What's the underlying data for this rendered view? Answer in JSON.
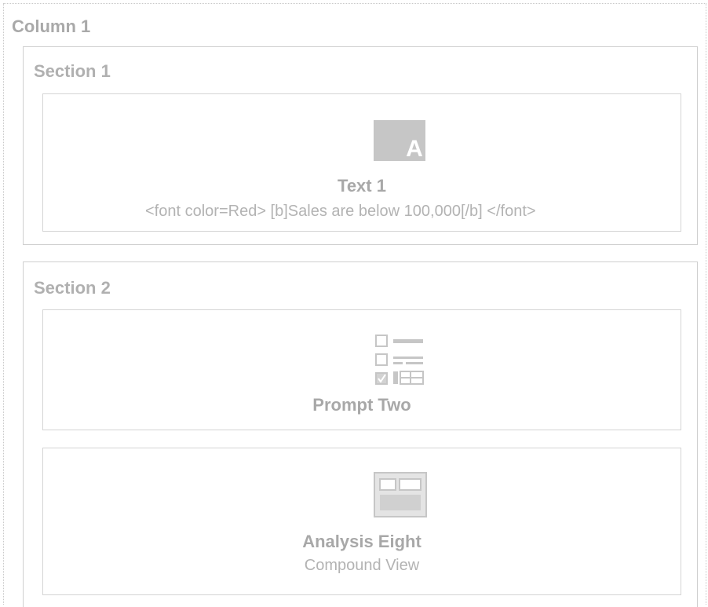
{
  "column": {
    "title": "Column 1"
  },
  "sections": [
    {
      "title": "Section 1",
      "items": [
        {
          "icon": "text-icon",
          "icon_letter": "A",
          "title": "Text 1",
          "subtitle": "<font color=Red> [b]Sales are below 100,000[/b] </font>"
        }
      ]
    },
    {
      "title": "Section 2",
      "items": [
        {
          "icon": "prompt-icon",
          "title": "Prompt Two"
        },
        {
          "icon": "compound-view-icon",
          "title": "Analysis Eight",
          "subtitle": "Compound View"
        }
      ]
    }
  ],
  "colors": {
    "text": "#a9a9a9",
    "border": "#cfcfcf",
    "icon_fill": "#c6c6c6"
  }
}
